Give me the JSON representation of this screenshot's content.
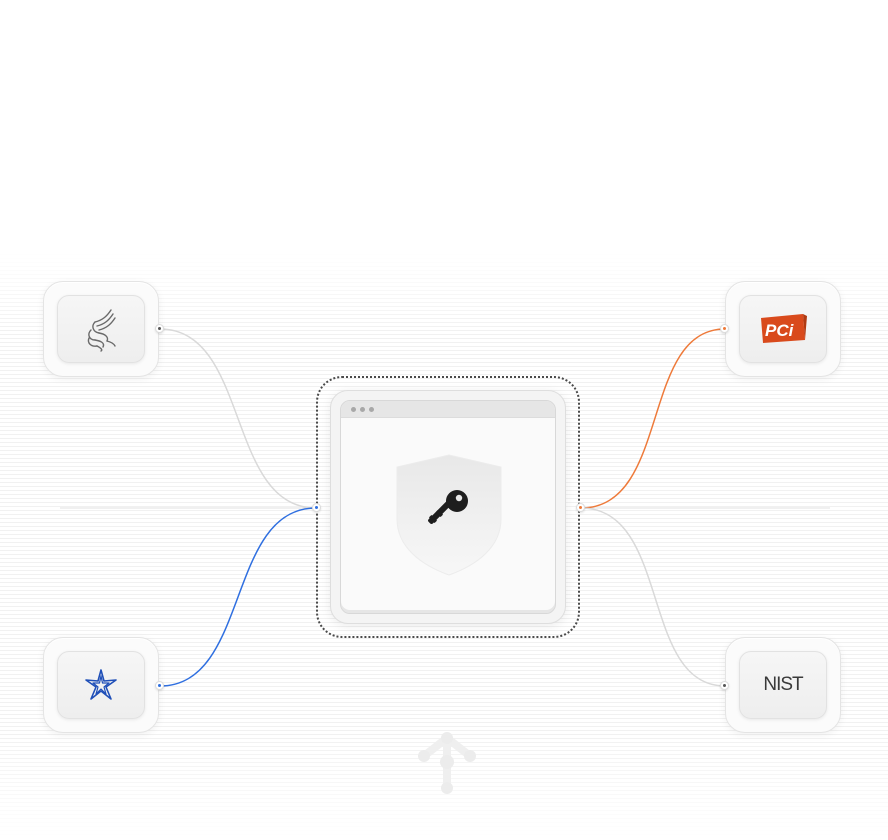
{
  "diagram": {
    "nodes": {
      "top_left": {
        "icon": "eagle-seal-icon"
      },
      "bottom_left": {
        "icon": "star-emblem-icon"
      },
      "top_right": {
        "icon": "pci-logo-icon",
        "logo_text": "PCi"
      },
      "bottom_right": {
        "icon": "nist-logo-icon",
        "logo_text": "NIST"
      },
      "center": {
        "icon": "shield-key-icon",
        "window_controls": 3
      },
      "bottom": {
        "icon": "branch-network-icon"
      }
    },
    "connections": [
      {
        "from": "top_left",
        "to": "center",
        "color": "#d9d9d9"
      },
      {
        "from": "bottom_left",
        "to": "center",
        "color": "#2f6fe0"
      },
      {
        "from": "center",
        "to": "top_right",
        "color": "#ee7a3a"
      },
      {
        "from": "center",
        "to": "bottom_right",
        "color": "#d9d9d9"
      }
    ],
    "colors": {
      "blue_accent": "#2f6fe0",
      "orange_accent": "#ee7a3a",
      "gray_line": "#d9d9d9",
      "pci_red": "#d94a1c",
      "star_blue": "#1f4fb8"
    }
  }
}
